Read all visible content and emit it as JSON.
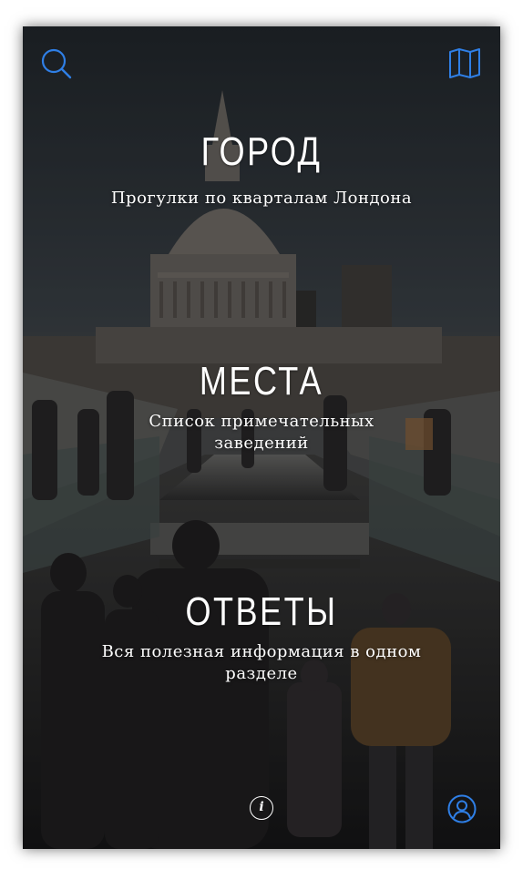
{
  "colors": {
    "accent": "#2f7fe6",
    "text": "#ffffff"
  },
  "header": {
    "search_icon": "search-icon",
    "map_icon": "map-icon"
  },
  "sections": [
    {
      "title": "ГОРОД",
      "subtitle": "Прогулки по кварталам Лондона"
    },
    {
      "title": "МЕСТА",
      "subtitle": "Список примечательных заведений"
    },
    {
      "title": "ОТВЕТЫ",
      "subtitle": "Вся полезная информация в одном разделе"
    }
  ],
  "footer": {
    "info_label": "i",
    "info_icon": "info-icon",
    "profile_icon": "user-icon"
  }
}
